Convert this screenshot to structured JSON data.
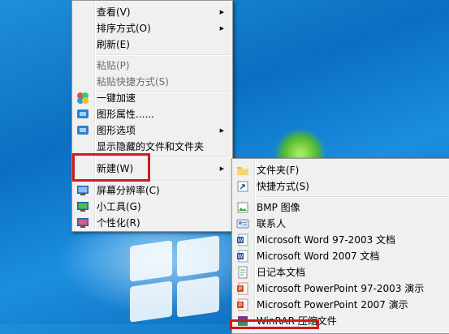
{
  "context_menu": {
    "items": [
      {
        "label": "查看(V)",
        "submenu": true
      },
      {
        "label": "排序方式(O)",
        "submenu": true
      },
      {
        "label": "刷新(E)"
      },
      {
        "label": "粘贴(P)",
        "disabled": true
      },
      {
        "label": "粘贴快捷方式(S)",
        "disabled": true
      },
      {
        "label": "一键加速",
        "icon": "speedup-icon"
      },
      {
        "label": "图形属性......",
        "icon": "graphics-properties-icon"
      },
      {
        "label": "图形选项",
        "icon": "graphics-options-icon",
        "submenu": true
      },
      {
        "label": "显示隐藏的文件和文件夹"
      },
      {
        "label": "新建(W)",
        "submenu": true,
        "highlighted": true
      },
      {
        "label": "屏幕分辨率(C)",
        "icon": "screen-resolution-icon"
      },
      {
        "label": "小工具(G)",
        "icon": "gadgets-icon"
      },
      {
        "label": "个性化(R)",
        "icon": "personalize-icon"
      }
    ]
  },
  "new_submenu": {
    "items": [
      {
        "label": "文件夹(F)",
        "icon": "folder-icon"
      },
      {
        "label": "快捷方式(S)",
        "icon": "shortcut-icon"
      },
      {
        "label": "BMP 图像",
        "icon": "bmp-icon"
      },
      {
        "label": "联系人",
        "icon": "contact-icon"
      },
      {
        "label": "Microsoft Word 97-2003 文档",
        "icon": "word-icon"
      },
      {
        "label": "Microsoft Word 2007 文档",
        "icon": "word-icon"
      },
      {
        "label": "日记本文档",
        "icon": "journal-icon"
      },
      {
        "label": "Microsoft PowerPoint 97-2003 演示",
        "icon": "powerpoint-icon"
      },
      {
        "label": "Microsoft PowerPoint 2007 演示",
        "icon": "powerpoint-icon"
      },
      {
        "label": "WinRAR 压缩文件",
        "icon": "winrar-icon"
      }
    ]
  },
  "colors": {
    "highlight_border": "#d11a1a",
    "menu_bg": "#f0f0f0",
    "disabled_text": "#6d6d6d"
  }
}
